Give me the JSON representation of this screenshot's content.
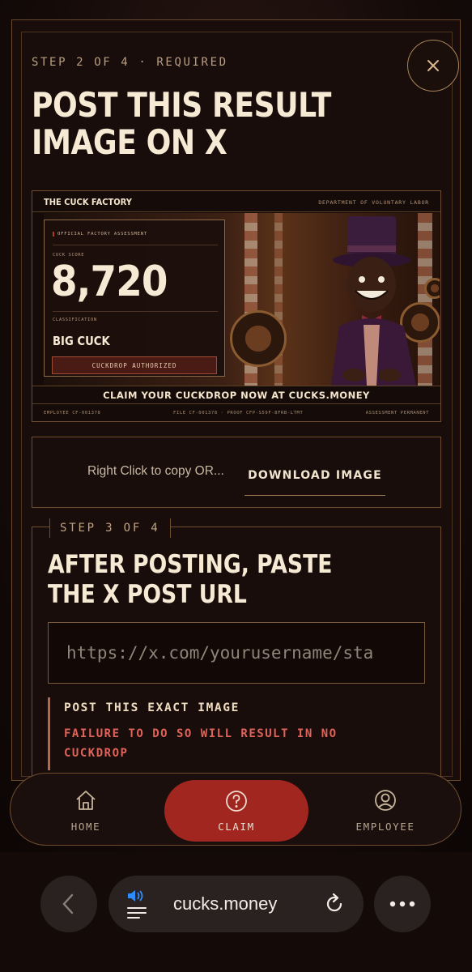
{
  "modal": {
    "step_label": "STEP 2 OF 4 · REQUIRED",
    "title": "POST THIS RESULT IMAGE ON X",
    "close_icon": "close-icon"
  },
  "result_card": {
    "brand": "THE CUCK FACTORY",
    "department": "DEPARTMENT OF VOLUNTARY LABOR",
    "assessment_tag": "OFFICIAL FACTORY ASSESSMENT",
    "score_label": "CUCK SCORE",
    "score": "8,720",
    "classification_label": "CLASSIFICATION",
    "classification": "BIG CUCK",
    "authorized": "CUCKDROP AUTHORIZED",
    "cta": "CLAIM YOUR CUCKDROP NOW AT CUCKS.MONEY",
    "footer_left": "EMPLOYEE CF-001378",
    "footer_center": "FILE CF-001378 · PROOF CFP-S59F-8FRB-LTMT",
    "footer_right": "ASSESSMENT PERMANENT"
  },
  "download": {
    "hint": "Right Click to copy OR...",
    "button_label": "DOWNLOAD IMAGE"
  },
  "step3": {
    "tag": "STEP 3 OF 4",
    "title_line1": "AFTER POSTING, PASTE",
    "title_line2": "THE X POST URL",
    "url_placeholder": "https://x.com/yourusername/sta",
    "warning_title": "POST THIS EXACT IMAGE",
    "warning_text": "FAILURE TO DO SO WILL RESULT IN NO CUCKDROP"
  },
  "nav": {
    "items": [
      {
        "label": "HOME",
        "icon": "home-icon"
      },
      {
        "label": "CLAIM",
        "icon": "help-circle-icon",
        "active": true
      },
      {
        "label": "EMPLOYEE",
        "icon": "user-circle-icon"
      }
    ]
  },
  "browser": {
    "url": "cucks.money"
  },
  "colors": {
    "accent_red": "#a0261f",
    "warning_red": "#e0635a",
    "border_gold": "#6e4d2e"
  }
}
